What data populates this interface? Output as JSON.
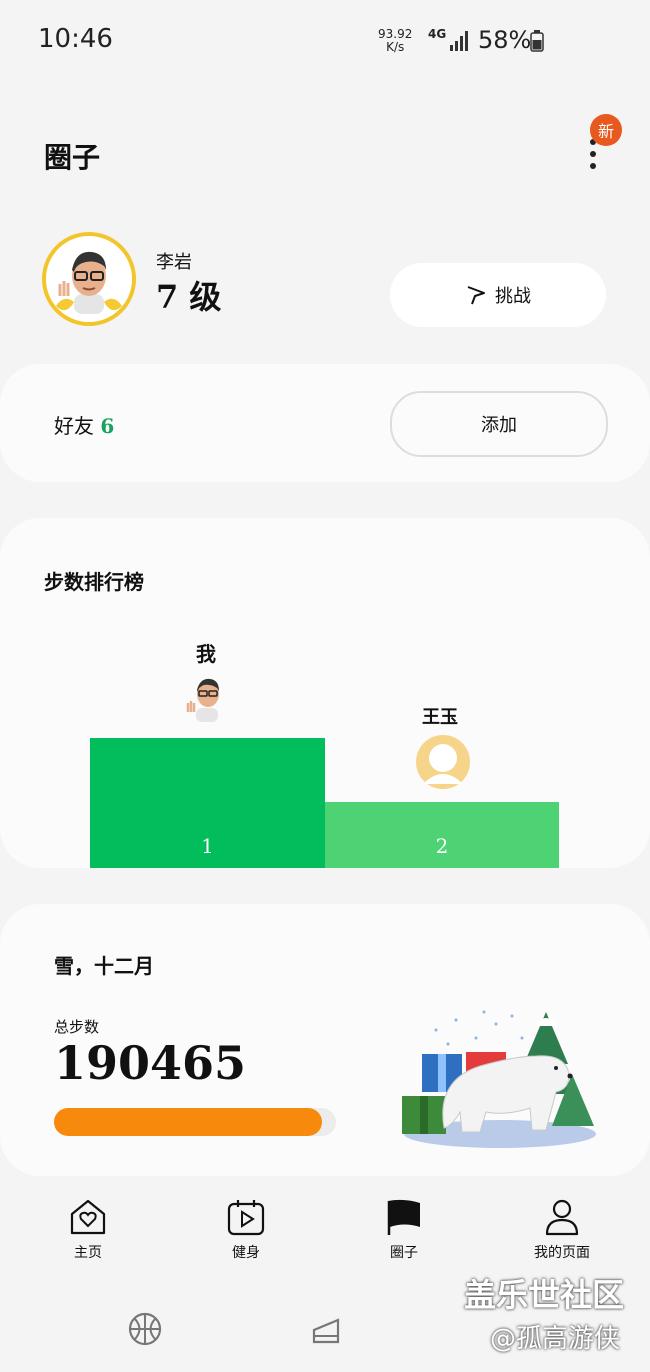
{
  "status_bar": {
    "time": "10:46",
    "net_speed_value": "93.92",
    "net_speed_unit": "K/s",
    "network": "4G",
    "battery": "58%"
  },
  "header": {
    "title": "圈子",
    "more_badge": "新",
    "more_icon": "more-vert-icon"
  },
  "profile": {
    "name": "李岩",
    "level": "7 级",
    "challenge_label": "挑战",
    "challenge_icon": "flag-outline-icon"
  },
  "friends": {
    "label": "好友",
    "count": "6",
    "add_label": "添加"
  },
  "leaderboard": {
    "title": "步数排行榜",
    "entries": [
      {
        "rank": "1",
        "name": "我",
        "steps_fraction": 1.0
      },
      {
        "rank": "2",
        "name": "王玉",
        "steps_fraction": 0.5
      }
    ],
    "colors": {
      "first": "#02bd5c",
      "second": "#4dd373"
    }
  },
  "monthly": {
    "title": "雪，十二月",
    "steps_label": "总步数",
    "steps_value": "190465",
    "progress_fraction": 0.95,
    "progress_color": "#f78a0c"
  },
  "nav": {
    "items": [
      {
        "label": "主页",
        "icon": "home-heart-icon"
      },
      {
        "label": "健身",
        "icon": "calendar-play-icon"
      },
      {
        "label": "圈子",
        "icon": "flag-filled-icon"
      },
      {
        "label": "我的页面",
        "icon": "person-icon"
      }
    ]
  },
  "watermark": {
    "main": "盖乐世社区",
    "sub": "@孤高游侠"
  }
}
